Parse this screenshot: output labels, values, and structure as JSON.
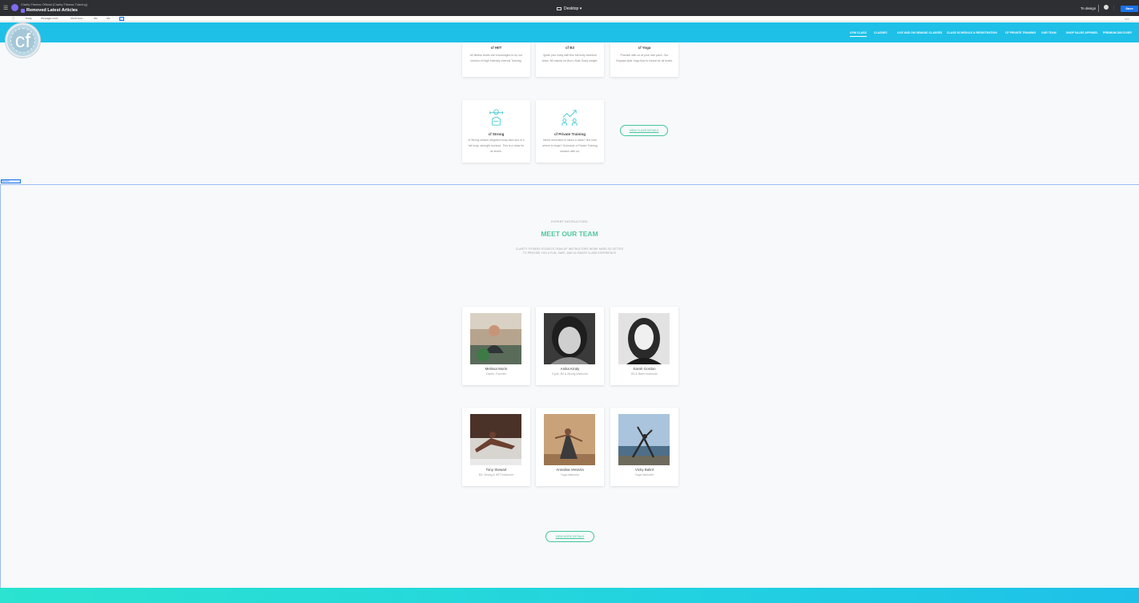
{
  "editor": {
    "site_name": "Clarity Fitness Official (Clarity Fitness Training)",
    "page_name": "Removed Latest Articles",
    "device": "Desktop",
    "redesign_label": "To design",
    "save_label": "Save",
    "breadcrumbs": [
      "body",
      "div.page-cont...",
      "div.bl-bou...",
      "div",
      "div"
    ],
    "selection_tag": "Section"
  },
  "nav": {
    "items": [
      "GYM CLASS",
      "CLASSES",
      "LIVE AND ON DEMAND CLASSES",
      "CLASS SCHEDULE & REGISTRATION",
      "CF PRIVATE TRAINING",
      "OUR TEAM",
      "SHOP SALES APPAREL",
      "PREMIUM DISCOVER"
    ],
    "logo_text": "cf"
  },
  "classes": [
    {
      "title": "cf HIIT",
      "desc": "All fitness levels are encouraged to try our version of High Intensity Interval Training."
    },
    {
      "title": "cf B3",
      "desc": "Ignite your body with this full body barefoot class. B3 stands for Burn, Bulk, Body weight."
    },
    {
      "title": "cf Yoga",
      "desc": "Practice with us at your own pace. Our Vinyasa style Yoga flow is meant for all levels."
    },
    {
      "title": "cf Strong",
      "desc": "cf Strong utilizes weighted body bars and is a full body, strength workout. This is a class for all levels."
    },
    {
      "title": "cf Private Training",
      "desc": "Never exercised or taken a class? Not sure where to begin? Schedule a Private Training session with us."
    }
  ],
  "view_class_details": "VIEW CLASS DETAILS",
  "team": {
    "eyebrow": "EXPERT INSTRUCTORS",
    "heading": "MEET OUR TEAM",
    "intro_line1": "CLARITY FITNESS STUDIO'S TEAM OF INSTRUCTORS WORK HARD SO ZETTES",
    "intro_line2": "TO PROVIDE YOU A FUN, SAFE, AND ULTIMATE CLASS EXPERIENCE",
    "members": [
      {
        "name": "Melissa Morin",
        "role": "Owner, Founder"
      },
      {
        "name": "Anika Kiraly",
        "role": "Cycle, B3 & Strong Instructor"
      },
      {
        "name": "Sarah Gordon",
        "role": "B3 & Barre Instructor"
      },
      {
        "name": "Tony Stewart",
        "role": "B3, Strong & HIIT Instructor"
      },
      {
        "name": "Annalisa Venezia",
        "role": "Yoga Instructor"
      },
      {
        "name": "Vicky Balint",
        "role": "Yoga Instructor"
      }
    ],
    "view_more": "VIEW MORE DETAILS"
  },
  "colors": {
    "nav": "#1ec0e8",
    "accent_green": "#53c99d",
    "editor_bar": "#2d2f33",
    "save_blue": "#1a73e8"
  }
}
